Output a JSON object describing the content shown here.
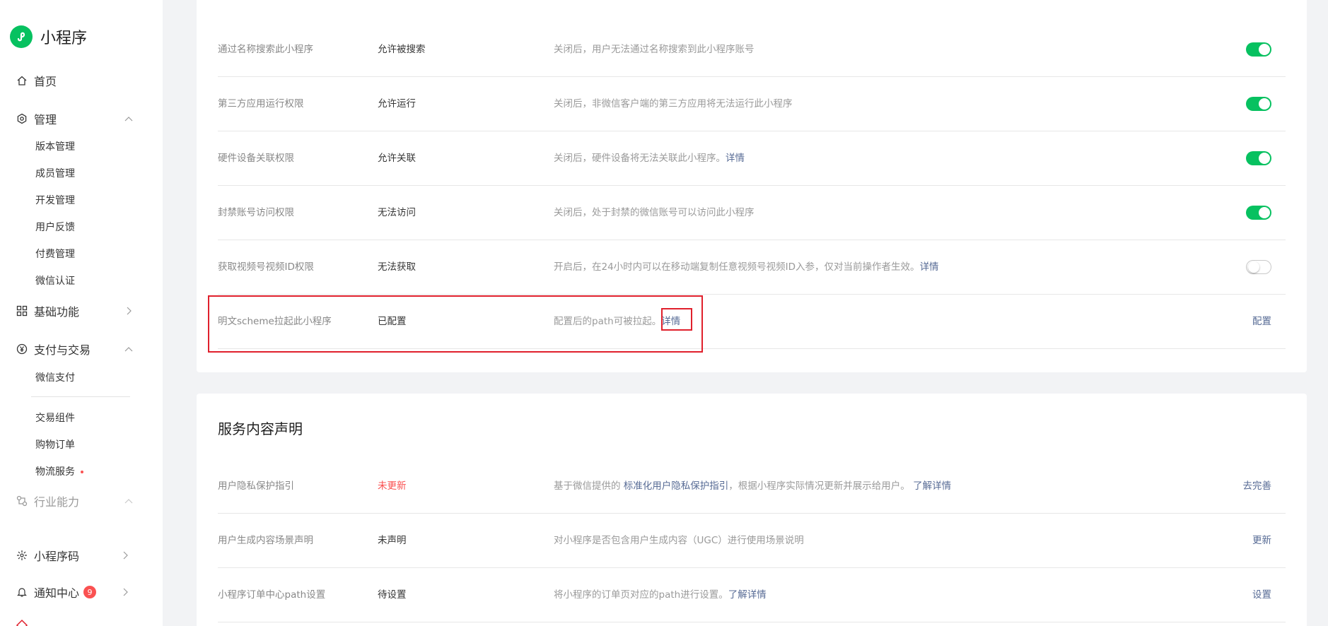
{
  "brand": {
    "title": "小程序"
  },
  "nav": {
    "home": "首页",
    "manage": {
      "label": "管理",
      "items": [
        "版本管理",
        "成员管理",
        "开发管理",
        "用户反馈",
        "付费管理",
        "微信认证"
      ]
    },
    "basic": "基础功能",
    "pay": {
      "label": "支付与交易",
      "items": [
        "微信支付",
        "交易组件",
        "购物订单",
        "物流服务"
      ]
    },
    "industry": "行业能力",
    "code": "小程序码",
    "notify": {
      "label": "通知中心",
      "badge": "9"
    }
  },
  "permissions": {
    "rows": [
      {
        "name": "通过名称搜索此小程序",
        "status": "允许被搜索",
        "desc": "关闭后，用户无法通过名称搜索到此小程序账号",
        "link": "",
        "toggle": "on"
      },
      {
        "name": "第三方应用运行权限",
        "status": "允许运行",
        "desc": "关闭后，非微信客户端的第三方应用将无法运行此小程序",
        "link": "",
        "toggle": "on"
      },
      {
        "name": "硬件设备关联权限",
        "status": "允许关联",
        "desc": "关闭后，硬件设备将无法关联此小程序。",
        "link": "详情",
        "toggle": "on"
      },
      {
        "name": "封禁账号访问权限",
        "status": "无法访问",
        "desc": "关闭后，处于封禁的微信账号可以访问此小程序",
        "link": "",
        "toggle": "on"
      },
      {
        "name": "获取视频号视频ID权限",
        "status": "无法获取",
        "desc": "开启后，在24小时内可以在移动端复制任意视频号视频ID入参，仅对当前操作者生效。",
        "link": "详情",
        "toggle": "off"
      },
      {
        "name": "明文scheme拉起此小程序",
        "status": "已配置",
        "desc": "配置后的path可被拉起。",
        "link": "详情",
        "action": "配置"
      }
    ]
  },
  "service": {
    "title": "服务内容声明",
    "rows": [
      {
        "name": "用户隐私保护指引",
        "status": "未更新",
        "desc_prefix": "基于微信提供的 ",
        "desc_link": "标准化用户隐私保护指引",
        "desc_suffix": "，根据小程序实际情况更新并展示给用户。 ",
        "desc_link2": "了解详情",
        "action": "去完善"
      },
      {
        "name": "用户生成内容场景声明",
        "status": "未声明",
        "desc_prefix": "对小程序是否包含用户生成内容（UGC）进行使用场景说明",
        "action": "更新"
      },
      {
        "name": "小程序订单中心path设置",
        "status": "待设置",
        "desc_prefix": "将小程序的订单页对应的path进行设置。",
        "desc_link": "了解详情",
        "action": "设置"
      }
    ]
  },
  "colors": {
    "accent": "#07c160",
    "link": "#576b95",
    "warn": "#fa5151",
    "highlight": "#e0202c"
  }
}
